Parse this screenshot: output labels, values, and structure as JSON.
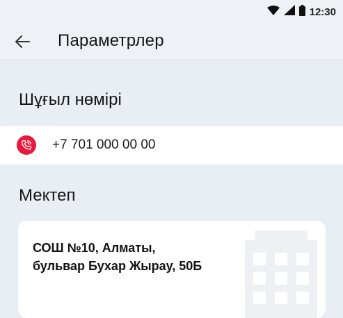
{
  "status_bar": {
    "time": "12:30",
    "icons": [
      "wifi-icon",
      "signal-icon",
      "battery-icon"
    ]
  },
  "app_bar": {
    "back_icon": "arrow-left-icon",
    "title": "Параметрлер"
  },
  "emergency": {
    "title": "Шұғыл нөмірі",
    "phone_icon": "phone-call-icon",
    "phone_number": "+7 701 000 00 00",
    "accent_color": "#e8193c"
  },
  "school": {
    "title": "Мектеп",
    "name_line1": "СОШ №10, Алматы,",
    "name_line2": "бульвар Бухар Жырау, 50Б",
    "icon": "building-icon"
  },
  "colors": {
    "background": "#e9eef5",
    "card": "#ffffff",
    "accent": "#e8193c"
  }
}
